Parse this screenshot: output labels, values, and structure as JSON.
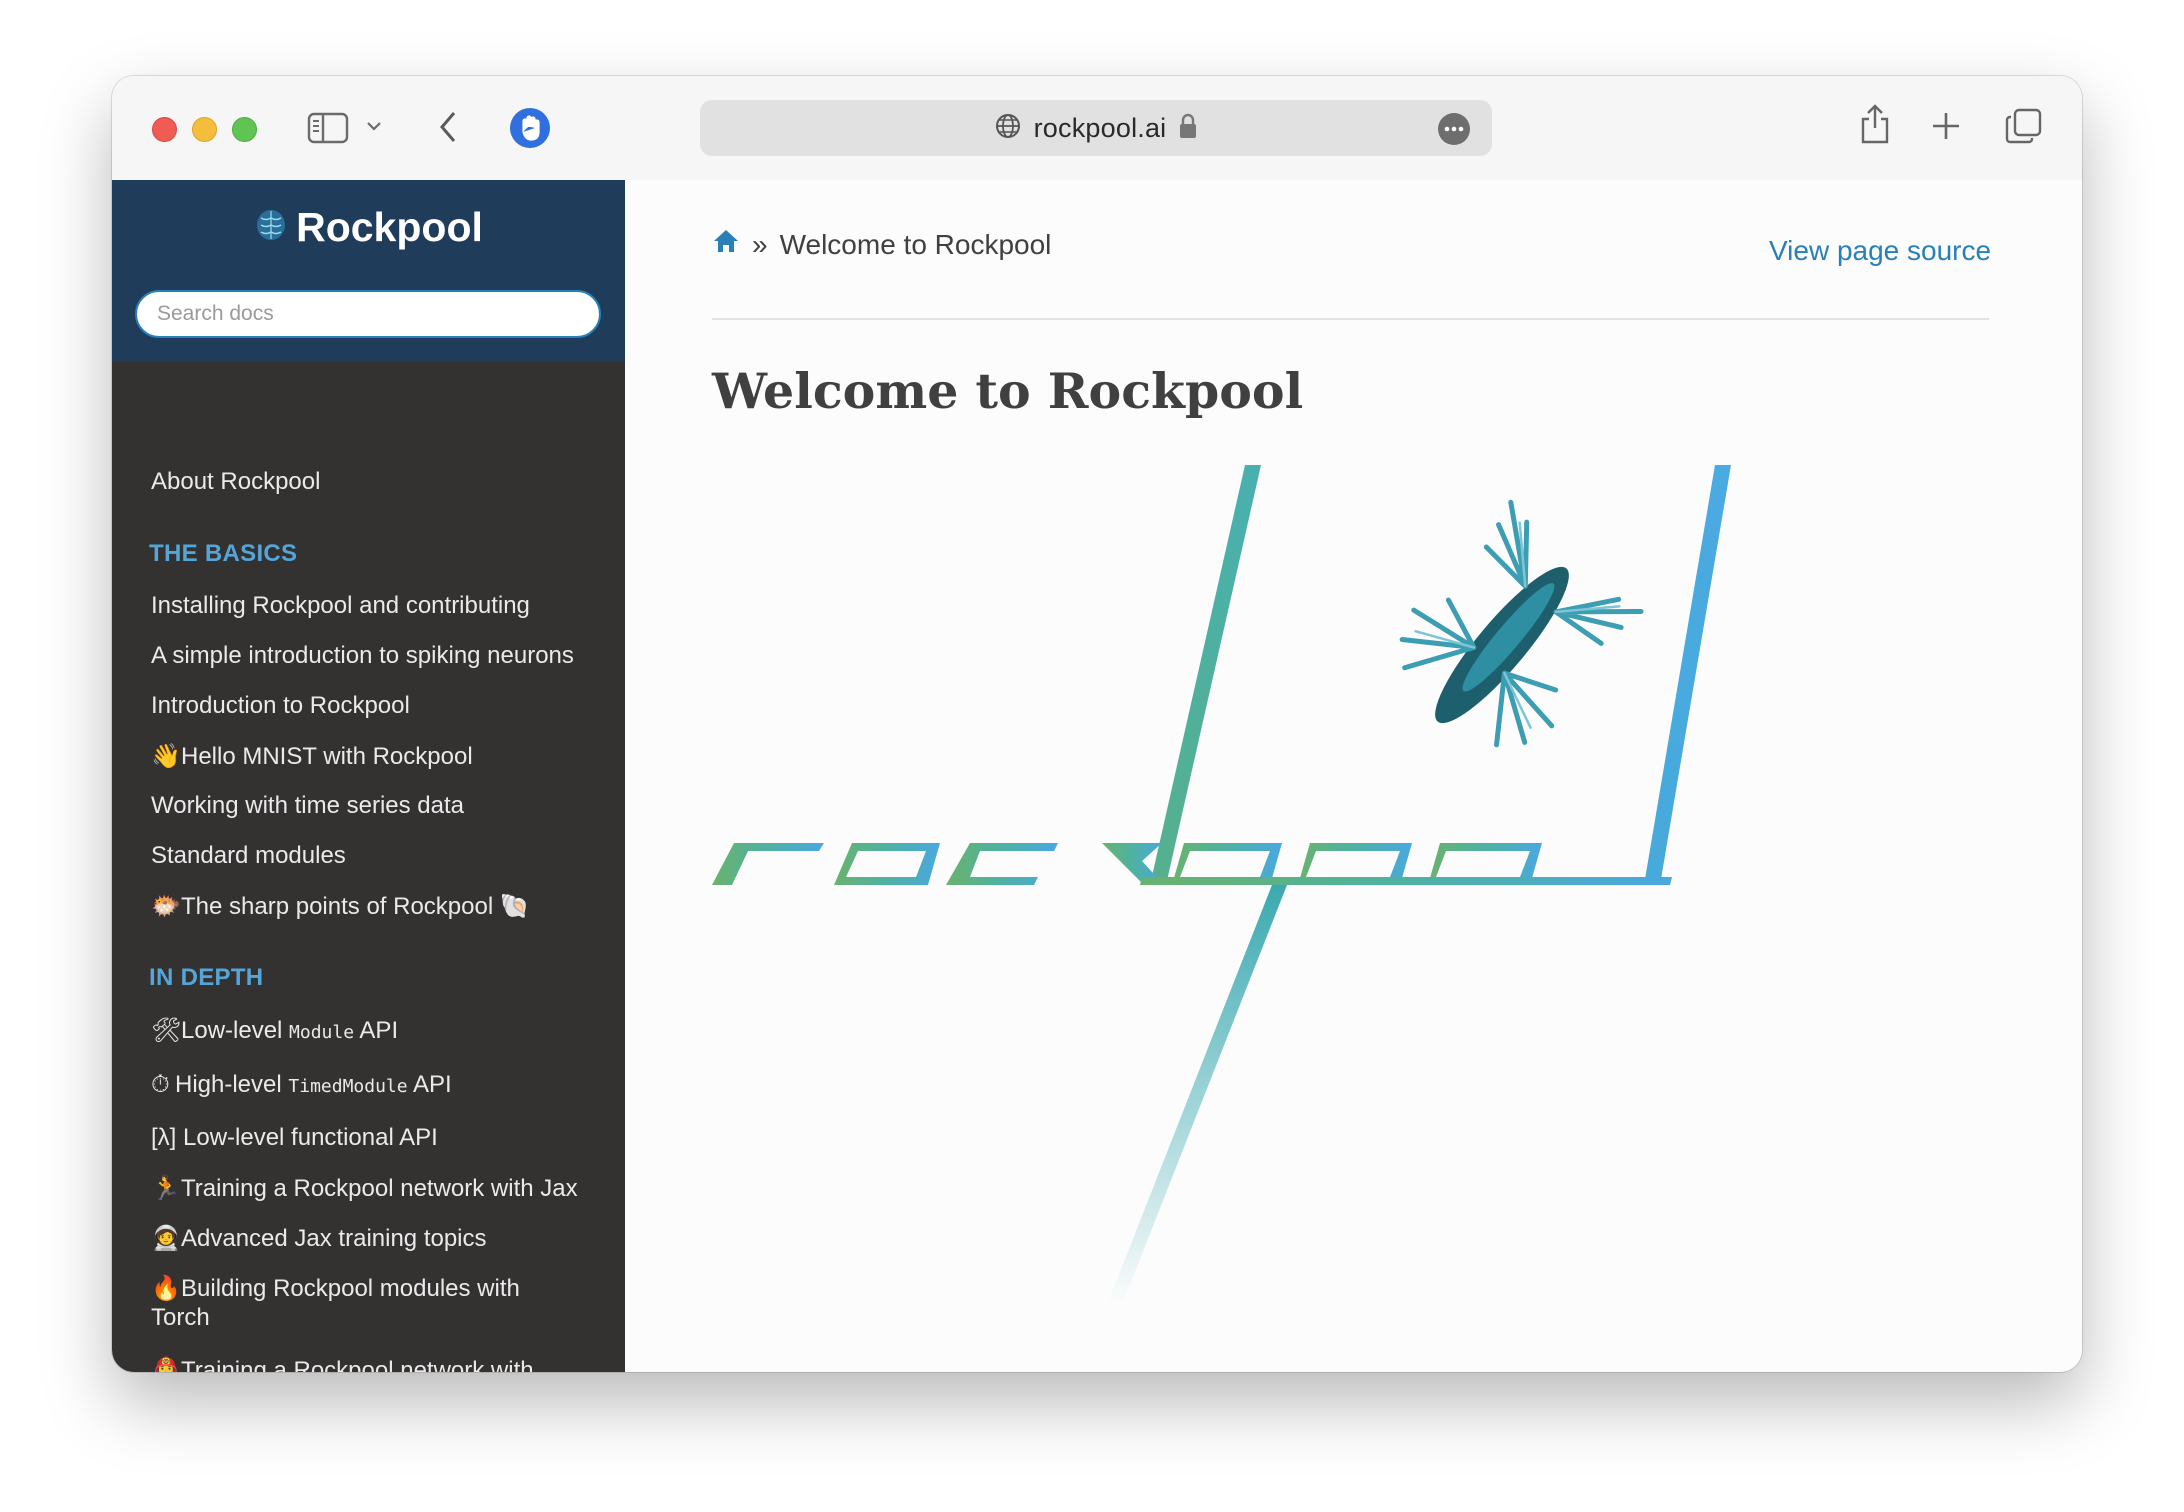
{
  "browser": {
    "url": "rockpool.ai",
    "icons": [
      "sidebar-icon",
      "chevron-down-icon",
      "back-arrow-icon",
      "hand-shield-icon",
      "globe-icon",
      "lock-icon",
      "more-icon",
      "share-icon",
      "plus-icon",
      "tabs-icon"
    ]
  },
  "sidebar": {
    "brand": "Rockpool",
    "search_placeholder": "Search docs",
    "about": "About Rockpool",
    "basics_caption": "THE BASICS",
    "basics": [
      {
        "emoji": "",
        "label": "Installing Rockpool and contributing"
      },
      {
        "emoji": "",
        "label": "A simple introduction to spiking neurons"
      },
      {
        "emoji": "",
        "label": "Introduction to Rockpool"
      },
      {
        "emoji": "👋",
        "label": "Hello MNIST with Rockpool"
      },
      {
        "emoji": "",
        "label": "Working with time series data"
      },
      {
        "emoji": "",
        "label": "Standard modules"
      },
      {
        "emoji": "🐡",
        "label": "The sharp points of Rockpool",
        "suffix": "🐚"
      }
    ],
    "depth_caption": "IN DEPTH",
    "depth": [
      {
        "emoji": "🛠",
        "pre": "Low-level ",
        "code": "Module",
        "post": " API"
      },
      {
        "emoji": "⏱",
        "pre": "High-level ",
        "code": "TimedModule",
        "post": " API"
      },
      {
        "emoji": "",
        "label": "[λ] Low-level functional API"
      },
      {
        "emoji": "🏃",
        "label": "Training a Rockpool network with Jax"
      },
      {
        "emoji": "🧑‍🚀",
        "label": "Advanced Jax training topics"
      },
      {
        "emoji": "🔥",
        "label": "Building Rockpool modules with",
        "label2": "Torch"
      },
      {
        "emoji": "👩‍🚒",
        "label": "Training a Rockpool network with"
      }
    ]
  },
  "content": {
    "breadcrumb_current": "Welcome to Rockpool",
    "breadcrumb_sep": "»",
    "view_source": "View page source",
    "title": "Welcome to Rockpool",
    "logo_text": "rockpool"
  },
  "colors": {
    "sidebar_bg": "#343131",
    "sidebar_head": "#1f3c5a",
    "link_blue": "#2980b9",
    "caption_blue": "#55a5d9",
    "logo_green": "#6bb26e",
    "logo_teal": "#3fb0b0",
    "logo_blue": "#4aa8e0"
  }
}
